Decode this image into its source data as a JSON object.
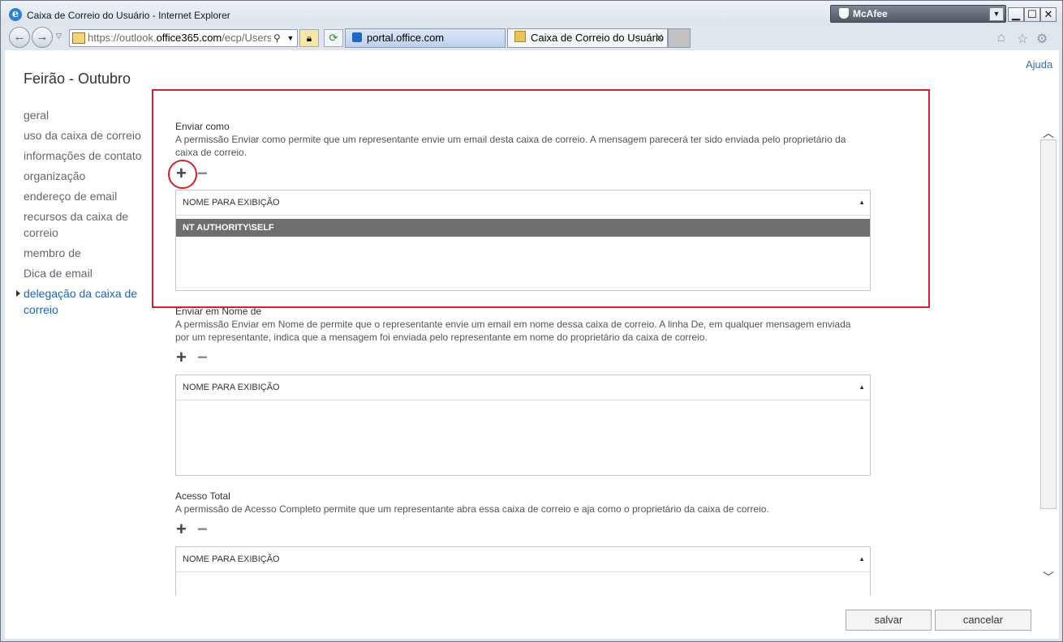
{
  "window": {
    "title": "Caixa de Correio do Usuário - Internet Explorer",
    "mcafee_label": "McAfee",
    "minimize": "▁",
    "maximize": "☐",
    "close": "✕"
  },
  "browser": {
    "url_prefix": "https://outlook.",
    "url_host": "office365.com",
    "url_path": "/ecp/UsersG",
    "tabs": [
      {
        "label": "portal.office.com"
      },
      {
        "label": "Caixa de Correio do Usuário"
      }
    ]
  },
  "page": {
    "help": "Ajuda",
    "title": "Feirão - Outubro"
  },
  "sidebar": {
    "items": [
      {
        "label": "geral"
      },
      {
        "label": "uso da caixa de correio"
      },
      {
        "label": "informações de contato"
      },
      {
        "label": "organização"
      },
      {
        "label": "endereço de email"
      },
      {
        "label": "recursos da caixa de correio"
      },
      {
        "label": "membro de"
      },
      {
        "label": "Dica de email"
      },
      {
        "label": "delegação da caixa de correio"
      }
    ],
    "active_index": 8
  },
  "sections": [
    {
      "title": "Enviar como",
      "description": "A permissão Enviar como permite que um representante envie um email desta caixa de correio. A mensagem parecerá ter sido enviada pelo proprietário da caixa de correio.",
      "column_header": "NOME PARA EXIBIÇÃO",
      "rows": [
        "NT AUTHORITY\\SELF"
      ]
    },
    {
      "title": "Enviar em Nome de",
      "description": "A permissão Enviar em Nome de permite que o representante envie um email em nome dessa caixa de correio. A linha De, em qualquer mensagem enviada por um representante, indica que a mensagem foi enviada pelo representante em nome do proprietário da caixa de correio.",
      "column_header": "NOME PARA EXIBIÇÃO",
      "rows": []
    },
    {
      "title": "Acesso Total",
      "description": "A permissão de Acesso Completo permite que um representante abra essa caixa de correio e aja como o proprietário da caixa de correio.",
      "column_header": "NOME PARA EXIBIÇÃO",
      "rows": []
    }
  ],
  "toolbar": {
    "add": "+",
    "remove": "−"
  },
  "footer": {
    "save": "salvar",
    "cancel": "cancelar"
  },
  "colors": {
    "highlight": "#d0202e",
    "link": "#2c6fb6",
    "selected_row": "#6e6e6e"
  }
}
